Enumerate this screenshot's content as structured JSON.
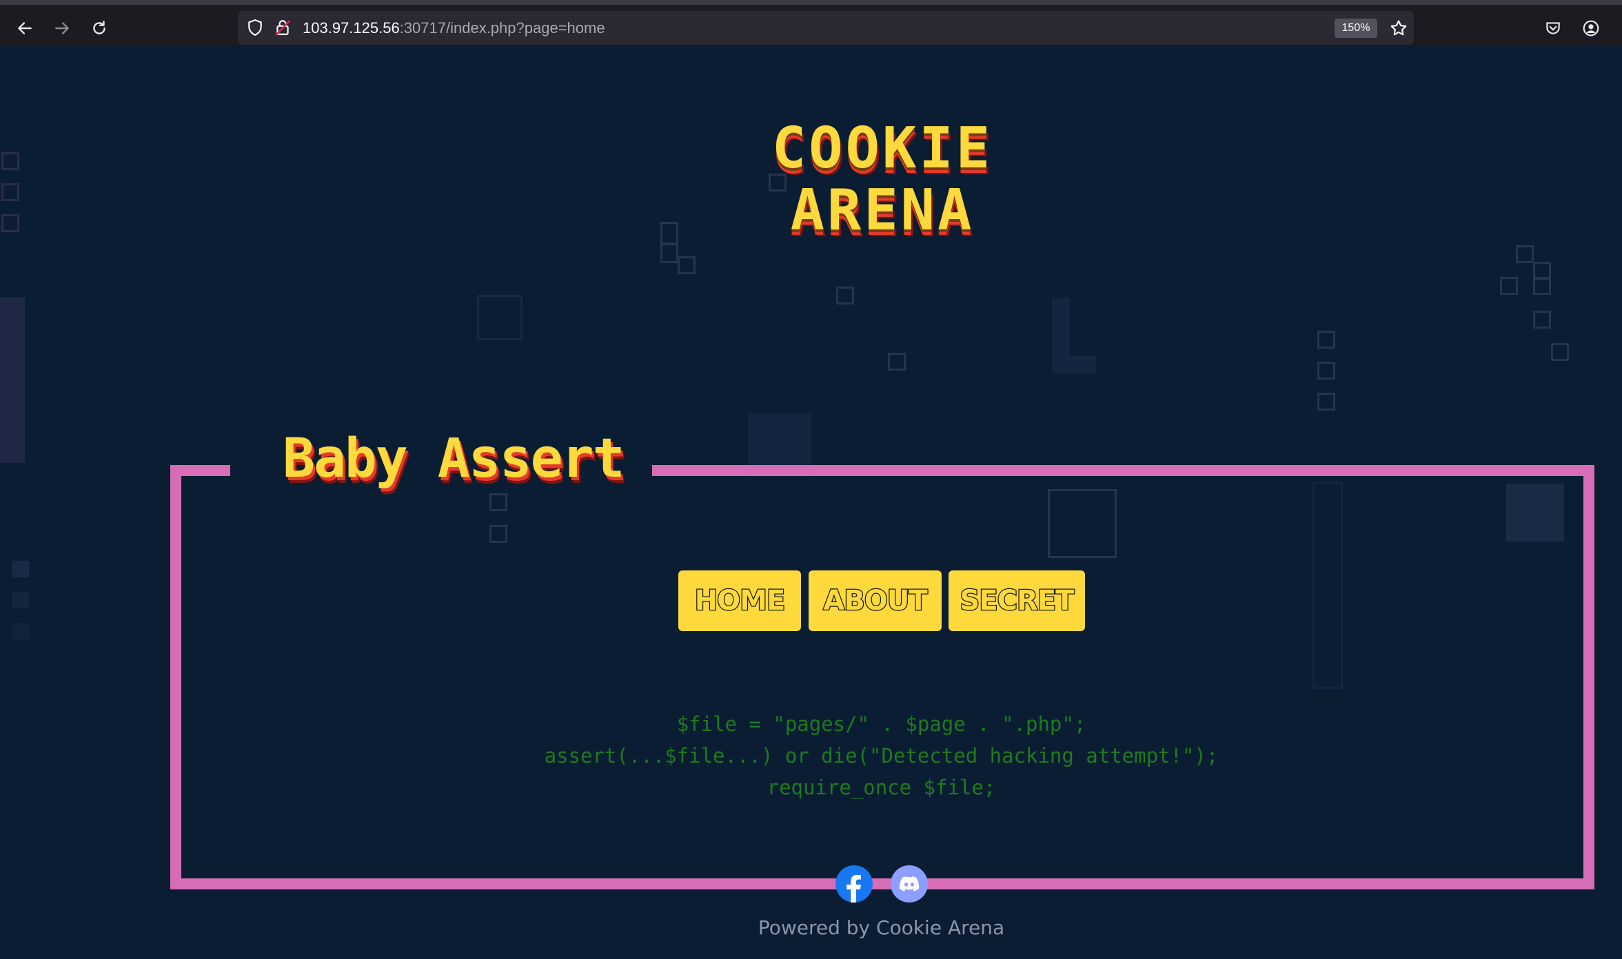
{
  "browser": {
    "url_host": "103.97.125.56",
    "url_rest": ":30717/index.php?page=home",
    "zoom": "150%",
    "icons": [
      "back-arrow-icon",
      "forward-arrow-icon",
      "reload-icon",
      "shield-icon",
      "insecure-lock-icon",
      "star-icon",
      "pocket-icon",
      "account-icon"
    ]
  },
  "site": {
    "logo_line1": "COOKIE",
    "logo_line2": "ARENA",
    "heading": "Baby Assert",
    "nav": [
      {
        "label": "HOME"
      },
      {
        "label": "ABOUT"
      },
      {
        "label": "SECRET"
      }
    ],
    "code_lines": [
      "$file = \"pages/\" . $page . \".php\";",
      "assert(...$file...) or die(\"Detected hacking attempt!\");",
      "require_once $file;"
    ],
    "social": [
      "facebook-icon",
      "discord-icon"
    ],
    "footer": "Powered by Cookie Arena"
  },
  "colors": {
    "background": "#0b1d33",
    "frame": "#d66db6",
    "accent_yellow": "#fdd93b",
    "code_green": "#1f7a1f"
  }
}
